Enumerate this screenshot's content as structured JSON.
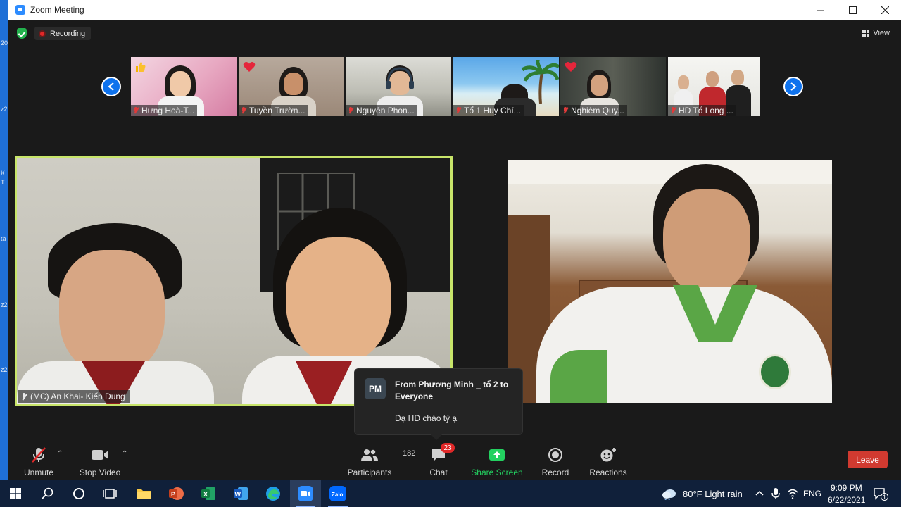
{
  "window": {
    "title": "Zoom Meeting"
  },
  "desktop_strip": {
    "labels": [
      "20",
      "z2",
      "K",
      "T",
      "tà",
      "z2",
      "z2"
    ]
  },
  "status": {
    "recording_label": "Recording",
    "view_label": "View"
  },
  "thumbnails": [
    {
      "name": "Hưng Hoà-T...",
      "reaction": "thumbs-up"
    },
    {
      "name": "Tuyền Trườn...",
      "reaction": "heart"
    },
    {
      "name": "Nguyên Phon...",
      "reaction": ""
    },
    {
      "name": "Tổ 1 Huy Chí...",
      "reaction": ""
    },
    {
      "name": "Nghiêm Quy...",
      "reaction": "heart"
    },
    {
      "name": "HD Tổ Long ...",
      "reaction": ""
    }
  ],
  "main_video": {
    "name": "(MC) An Khai- Kiến Dung"
  },
  "chat_popup": {
    "avatar": "PM",
    "from": "From Phương Minh _ tổ 2 to Everyone",
    "message": "Dạ HĐ chào tỷ ạ"
  },
  "toolbar": {
    "unmute": "Unmute",
    "stop_video": "Stop Video",
    "participants": "Participants",
    "participants_count": "182",
    "chat": "Chat",
    "chat_badge": "23",
    "share_screen": "Share Screen",
    "record": "Record",
    "reactions": "Reactions",
    "leave": "Leave"
  },
  "taskbar": {
    "weather": "80°F  Light rain",
    "language": "ENG",
    "time": "9:09 PM",
    "date": "6/22/2021",
    "notifications": "1"
  },
  "colors": {
    "zoom_blue": "#0e72ed",
    "active_speaker": "#c8e56a",
    "share_green": "#23d160",
    "leave_red": "#d13a30",
    "taskbar_bg": "#10203a"
  }
}
